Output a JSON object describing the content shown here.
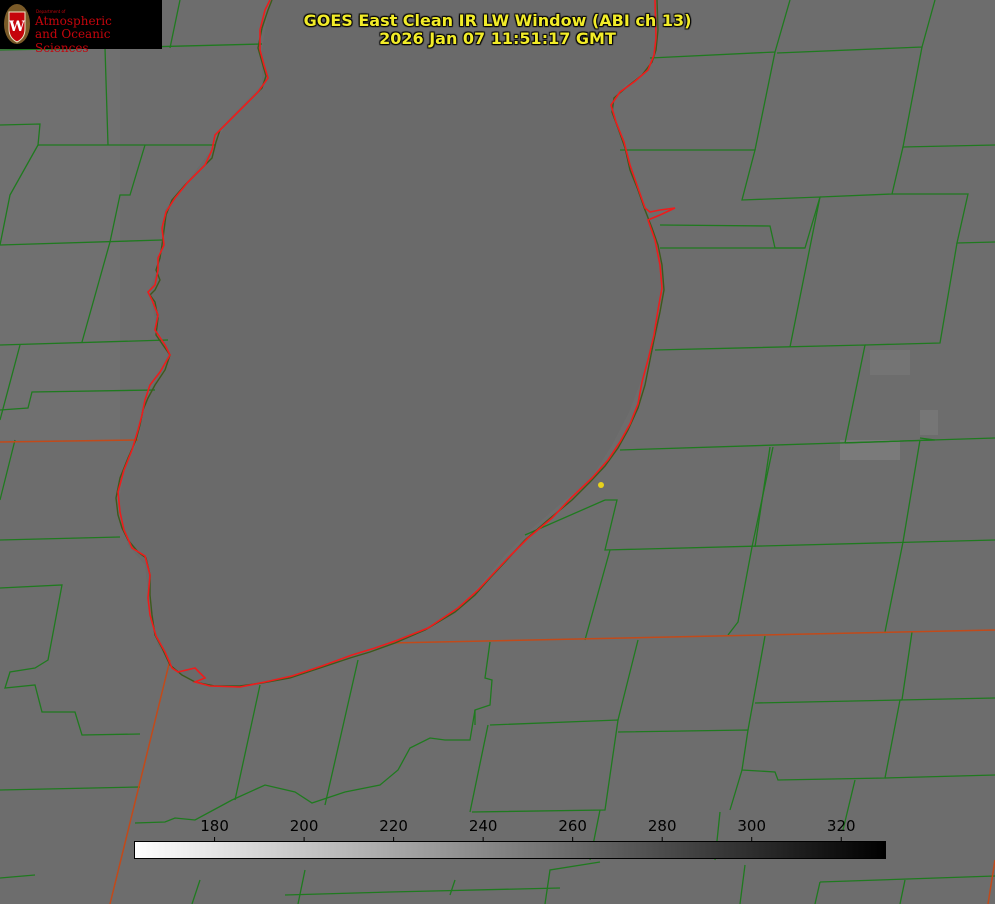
{
  "title": {
    "line1": "GOES East Clean IR LW Window (ABI ch 13)",
    "line2": "2026 Jan 07 11:51:17 GMT"
  },
  "logo": {
    "dept": "Department of",
    "line1": "Atmospheric",
    "line2": "and Oceanic Sciences",
    "seal_letter": "W"
  },
  "colorbar": {
    "ticks": [
      "180",
      "200",
      "220",
      "240",
      "260",
      "280",
      "300",
      "320"
    ],
    "range_min": 162,
    "range_max": 330,
    "gradient_start": "#ffffff",
    "gradient_end": "#000000"
  },
  "colors": {
    "county_lines": "#1f7a1f",
    "shoreline": "#ee1c1c",
    "state_line": "#c24a1a",
    "title_text": "#f2ec29",
    "marker": "#e8d21c",
    "background": "#6e6e6e"
  }
}
